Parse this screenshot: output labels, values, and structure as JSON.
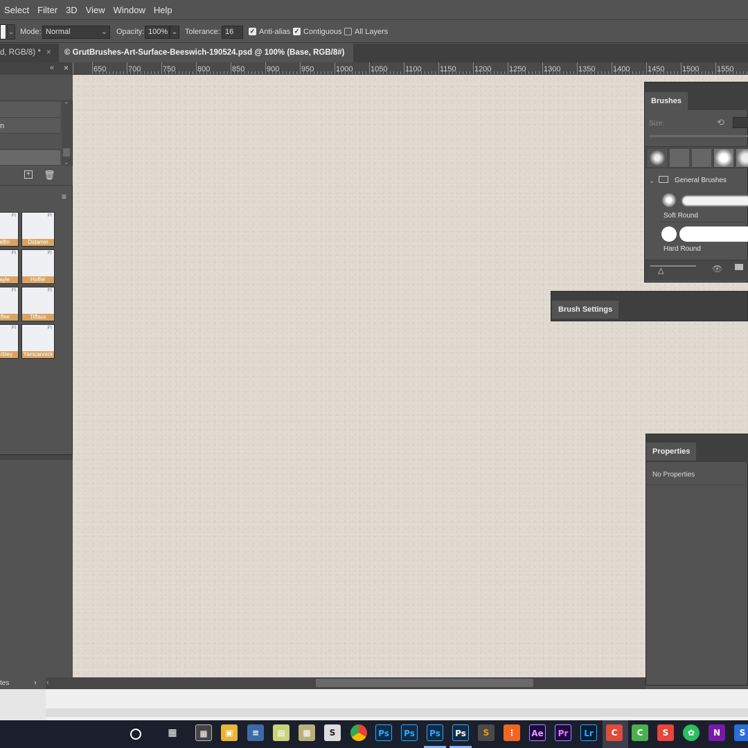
{
  "menu": [
    "Select",
    "Filter",
    "3D",
    "View",
    "Window",
    "Help"
  ],
  "options": {
    "mode_label": "Mode:",
    "mode_value": "Normal",
    "opacity_label": "Opacity:",
    "opacity_value": "100%",
    "tolerance_label": "Tolerance:",
    "tolerance_value": "16",
    "anti_alias": "Anti-alias",
    "contiguous": "Contiguous",
    "all_layers": "All Layers"
  },
  "tabs": [
    {
      "label": "d, RGB/8) *"
    },
    {
      "label": "© GrutBrushes-Art-Surface-Beeswich-190524.psd @ 100% (Base, RGB/8#) *"
    }
  ],
  "ruler": [
    "650",
    "700",
    "750",
    "800",
    "850",
    "900",
    "950",
    "1000",
    "1050",
    "1100",
    "1150",
    "1200",
    "1250",
    "1300",
    "1350",
    "1400",
    "1450",
    "1500",
    "1550"
  ],
  "left_panel": {
    "rows": [
      "",
      "n",
      "",
      ""
    ],
    "swatches": [
      {
        "name": "elfin",
        "col": "left"
      },
      {
        "name": "Didamin",
        "col": "right"
      },
      {
        "name": "ayle",
        "col": "left"
      },
      {
        "name": "Hoffer",
        "col": "right"
      },
      {
        "name": "ffee",
        "col": "left"
      },
      {
        "name": "Tiffaux",
        "col": "right"
      },
      {
        "name": "rbley",
        "col": "left"
      },
      {
        "name": "Yamcannick",
        "col": "right"
      }
    ],
    "fi": "FI",
    "bottom_label": "tes"
  },
  "brushes": {
    "title": "Brushes",
    "size_label": "Size:",
    "group": "General Brushes",
    "items": [
      "Soft Round",
      "Hard Round"
    ]
  },
  "brush_settings": {
    "title": "Brush Settings"
  },
  "properties": {
    "title": "Properties",
    "empty": "No Properties"
  },
  "taskbar": [
    "cortana",
    "task-view",
    "calculator",
    "file-explorer",
    "app-list",
    "spreadsheet",
    "map-app",
    "scrivener",
    "chrome",
    "Ps",
    "Ps",
    "Ps",
    "Ps",
    "sublime",
    "app-orange",
    "Ae",
    "Pr",
    "Lr",
    "C",
    "C",
    "S",
    "evernote",
    "N",
    "S"
  ],
  "colors": {
    "accent": "#8ab4f8",
    "canvas": "#dfd9cf",
    "panel": "#535353"
  }
}
